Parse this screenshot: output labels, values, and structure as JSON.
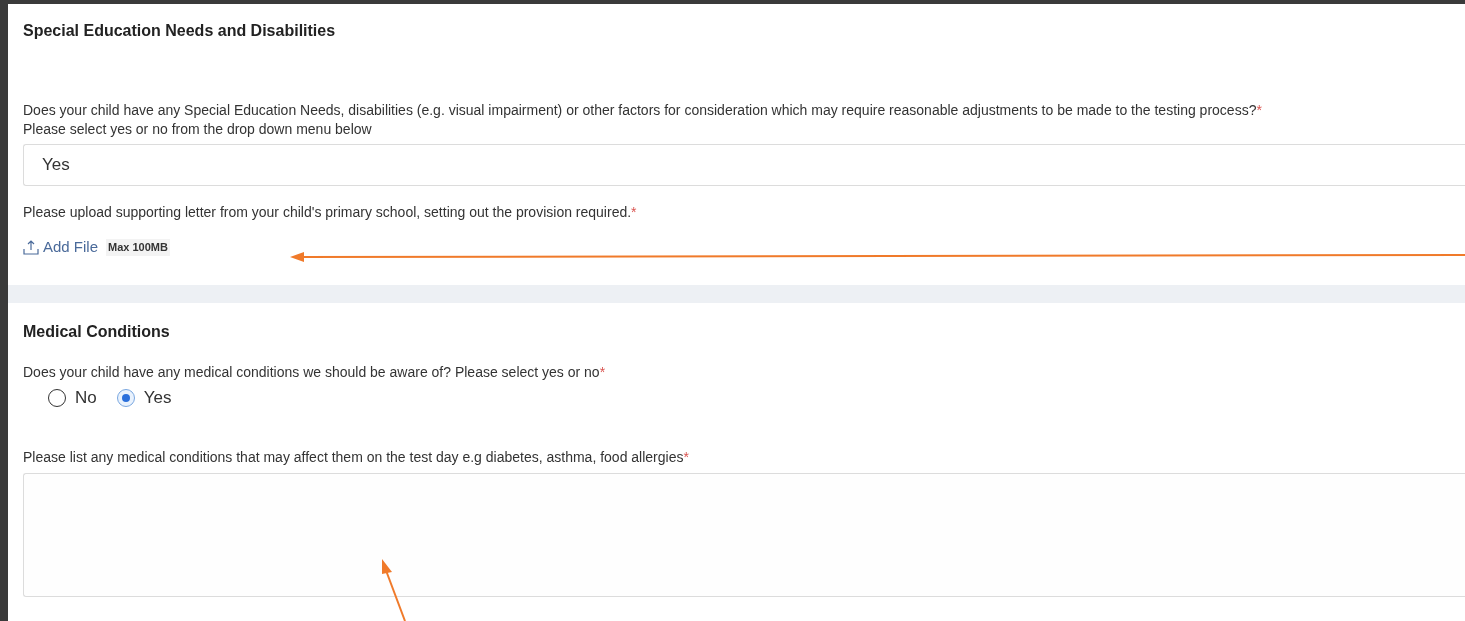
{
  "sen_section": {
    "title": "Special Education Needs and Disabilities",
    "question": {
      "label": "Does your child have any Special Education Needs, disabilities (e.g. visual impairment) or other factors for consideration which may require reasonable adjustments to be made to the testing process?",
      "required_mark": "*",
      "hint": "Please select yes or no from the drop down menu below",
      "value": "Yes"
    },
    "upload": {
      "label": "Please upload supporting letter from your child's primary school, setting out the provision required.",
      "required_mark": "*",
      "button": "Add File",
      "limit": "Max 100MB"
    }
  },
  "medical_section": {
    "title": "Medical Conditions",
    "question": {
      "label": "Does your child have any medical conditions we should be aware of? Please select yes or no",
      "required_mark": "*",
      "options": [
        {
          "label": "No",
          "selected": false
        },
        {
          "label": "Yes",
          "selected": true
        }
      ]
    },
    "details": {
      "label": "Please list any medical conditions that may affect them on the test day e.g diabetes, asthma, food allergies",
      "required_mark": "*"
    }
  }
}
